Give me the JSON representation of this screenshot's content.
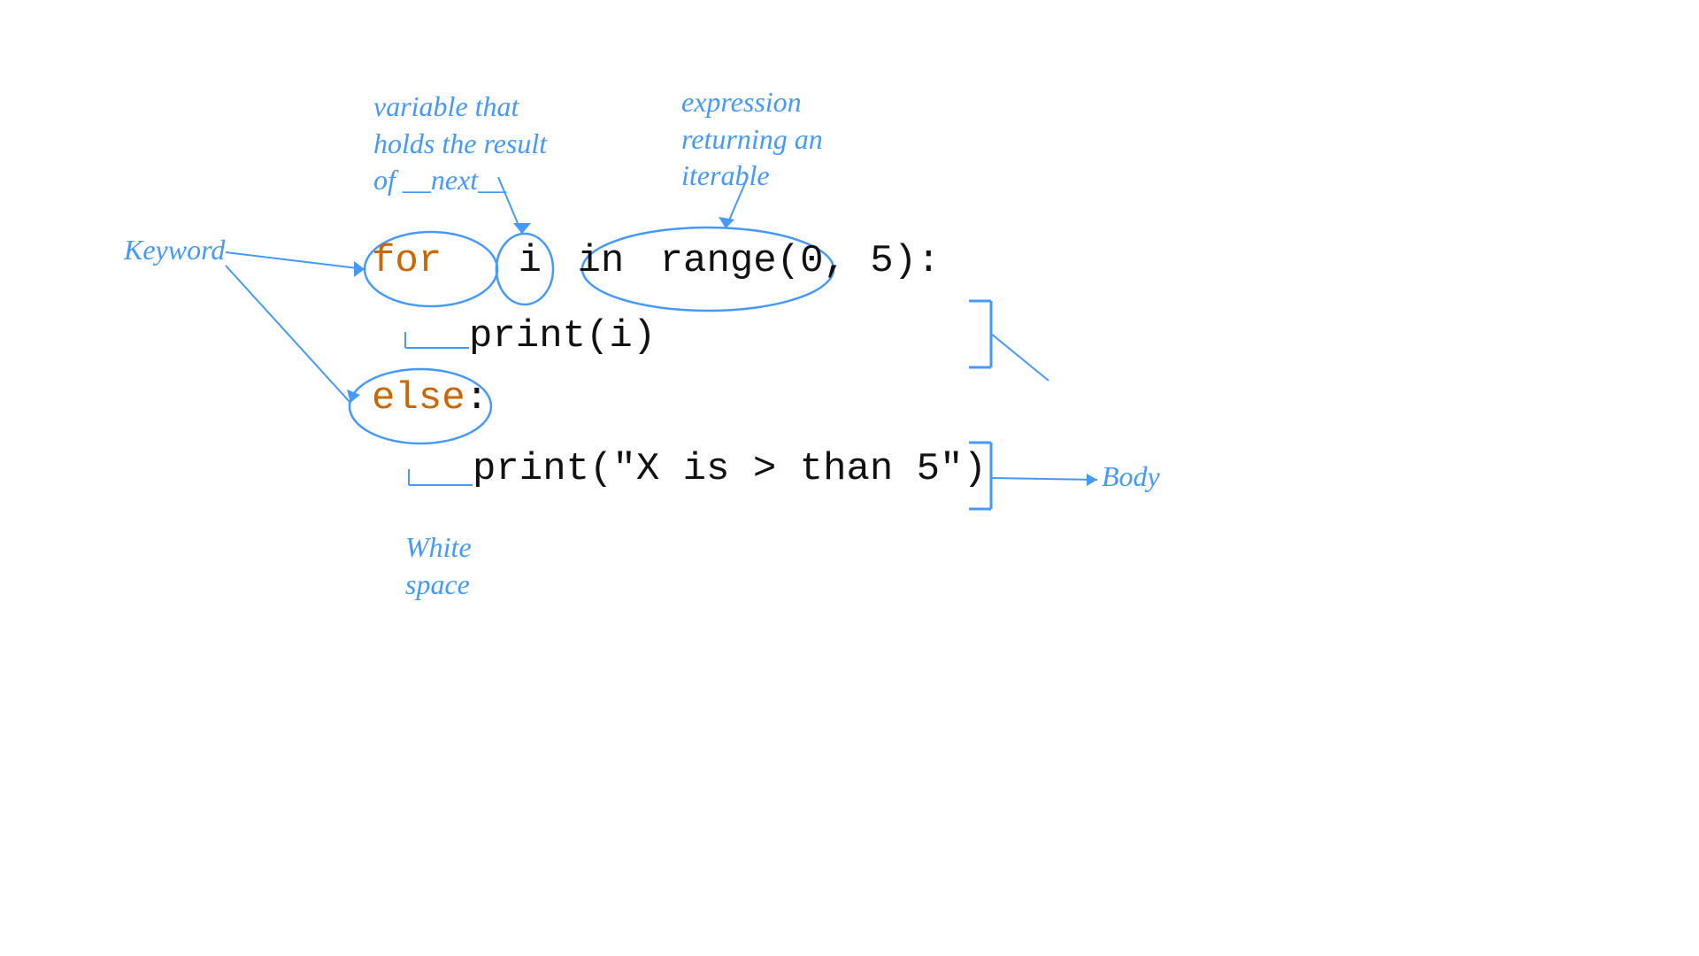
{
  "annotations": {
    "variable_label": "variable that\nholds the result\nof __next__",
    "expression_label": "expression\nreturning an\niterable",
    "keyword_label": "Keyword",
    "whitespace_label": "White\nspace",
    "body_label": "Body"
  },
  "code": {
    "for_keyword": "for",
    "variable_i": "i",
    "in_keyword": "in",
    "range_expr": "range(0, 5):",
    "print_i": "    print(i)",
    "else_keyword": "else",
    "colon": ":",
    "print_x": "        print(\"X is > than 5\")"
  },
  "colors": {
    "blue": "#4499ff",
    "orange": "#cc6600",
    "black": "#111111",
    "white": "#ffffff"
  }
}
